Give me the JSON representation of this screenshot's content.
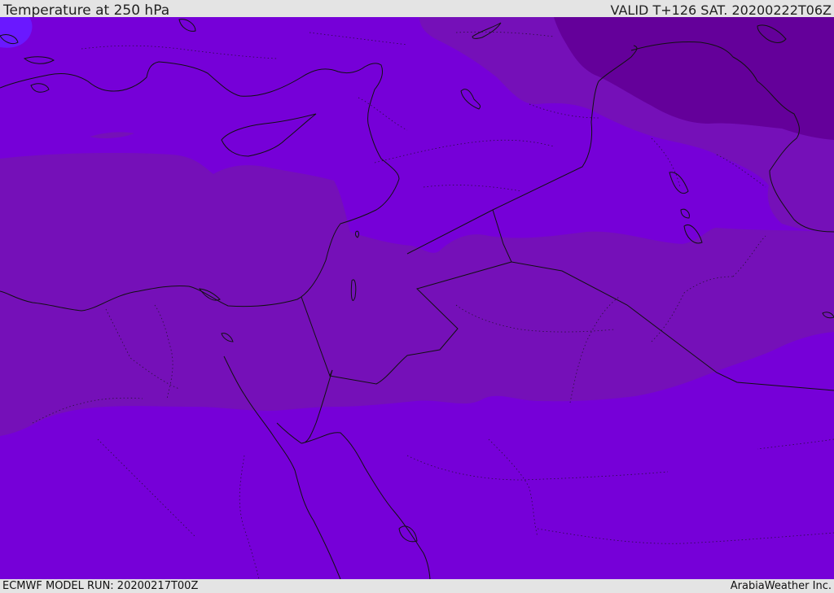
{
  "header": {
    "title": "Temperature at 250 hPa",
    "valid": "VALID T+126 SAT. 20200222T06Z"
  },
  "footer": {
    "model_run": "ECMWF MODEL RUN: 20200217T00Z",
    "credit": "ArabiaWeather Inc."
  },
  "map": {
    "colors": {
      "cold_band": "#7600d8",
      "mid_band": "#7510b8",
      "dark_band": "#64009a",
      "cell": "#6a18ff",
      "coast": "#111111"
    }
  }
}
